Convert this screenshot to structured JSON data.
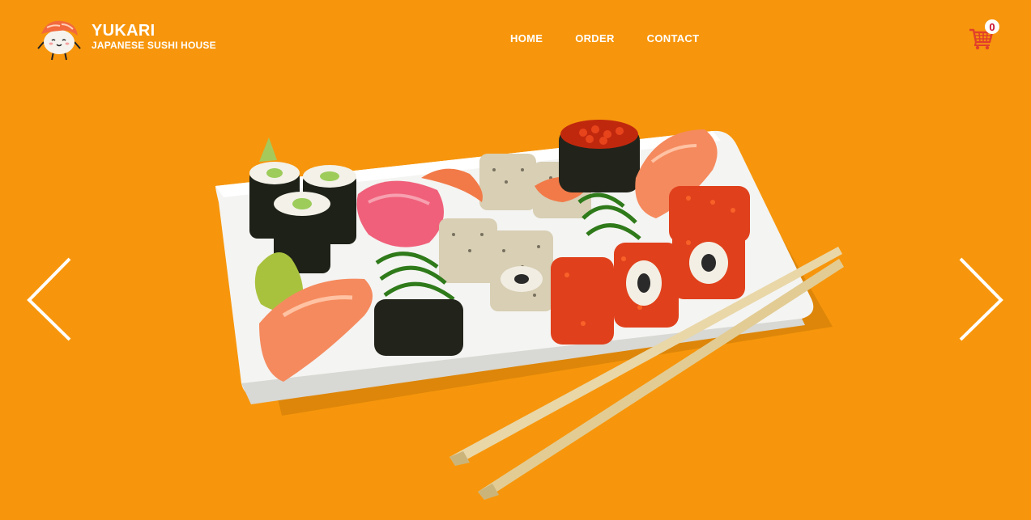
{
  "brand": {
    "name": "YUKARI",
    "subtitle": "JAPANESE SUSHI HOUSE",
    "logo_icon": "sushi-mascot-icon"
  },
  "nav": {
    "items": [
      {
        "label": "HOME"
      },
      {
        "label": "ORDER"
      },
      {
        "label": "CONTACT"
      }
    ]
  },
  "cart": {
    "count": "0",
    "icon": "shopping-cart-icon",
    "color": "#e2402a"
  },
  "slider": {
    "prev_icon": "chevron-left-icon",
    "next_icon": "chevron-right-icon",
    "hero_image": "sushi-platter-with-chopsticks"
  },
  "colors": {
    "background": "#f7960c",
    "text": "#ffffff",
    "badge_text": "#c8102e"
  }
}
